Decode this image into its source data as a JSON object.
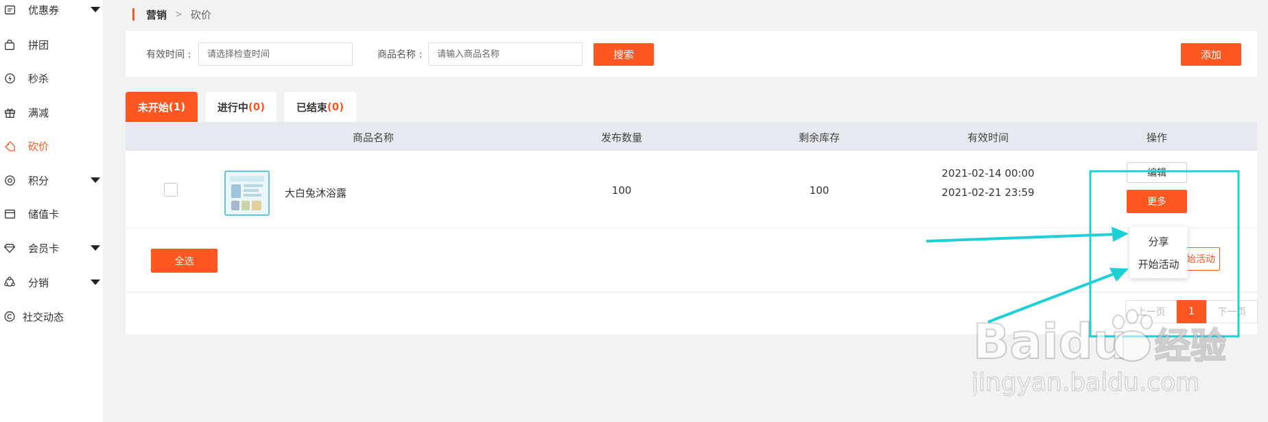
{
  "sidebar": {
    "items": [
      {
        "label": "优惠券",
        "icon": "ticket-icon",
        "has_caret": true
      },
      {
        "label": "拼团",
        "icon": "bag-icon",
        "has_caret": false
      },
      {
        "label": "秒杀",
        "icon": "flash-icon",
        "has_caret": false
      },
      {
        "label": "满减",
        "icon": "gift-icon",
        "has_caret": false
      },
      {
        "label": "砍价",
        "icon": "tag-icon",
        "has_caret": false,
        "active": true
      },
      {
        "label": "积分",
        "icon": "points-icon",
        "has_caret": true
      },
      {
        "label": "储值卡",
        "icon": "card-icon",
        "has_caret": false
      },
      {
        "label": "会员卡",
        "icon": "diamond-icon",
        "has_caret": true
      },
      {
        "label": "分销",
        "icon": "share-nodes-icon",
        "has_caret": true
      },
      {
        "label": "社交动态",
        "icon": "copyright-icon",
        "has_caret": false
      }
    ]
  },
  "breadcrumb": {
    "root": "营销",
    "separator": ">",
    "current": "砍价"
  },
  "filters": {
    "time_label": "有效时间 :",
    "time_placeholder": "请选择检查时间",
    "name_label": "商品名称 :",
    "name_placeholder": "请输入商品名称",
    "search_button": "搜索",
    "add_button": "添加"
  },
  "tabs": [
    {
      "label": "未开始",
      "count": "(1)",
      "active": true
    },
    {
      "label": "进行中",
      "count": "(0)",
      "active": false
    },
    {
      "label": "已结束",
      "count": "(0)",
      "active": false
    }
  ],
  "table": {
    "headers": [
      "商品名称",
      "发布数量",
      "剩余库存",
      "有效时间",
      "操作"
    ],
    "rows": [
      {
        "name": "大白兔沐浴露",
        "quantity": "100",
        "stock": "100",
        "time_start": "2021-02-14 00:00",
        "time_end": "2021-02-21 23:59",
        "edit_button": "编辑",
        "more_button": "更多"
      }
    ],
    "select_all_button": "全选"
  },
  "more_menu": {
    "items": [
      "分享",
      "开始活动"
    ]
  },
  "hidden_action": "开始活动",
  "pagination": {
    "prev": "上一页",
    "current": "1",
    "next": "下一页"
  },
  "watermark": {
    "brand": "Baidu",
    "brand_suffix": "经验",
    "url": "jingyan.baidu.com"
  },
  "colors": {
    "accent": "#ff5722",
    "annotation": "#1ecfd6"
  }
}
